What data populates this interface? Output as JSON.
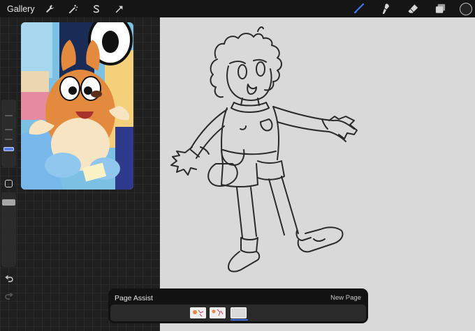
{
  "topbar": {
    "gallery_label": "Gallery",
    "left_tools": [
      "wrench-icon",
      "magic-wand-icon",
      "selection-icon",
      "transform-arrow-icon"
    ],
    "right_tools": [
      "brush-icon",
      "smudge-icon",
      "eraser-icon",
      "layers-icon"
    ],
    "active_tool": "brush-icon",
    "accent_color": "#3d7bf5",
    "current_color": "#232323"
  },
  "sidebar": {
    "size_level": 0.25,
    "opacity_level": 0.9
  },
  "page_assist": {
    "title": "Page Assist",
    "new_page_label": "New Page",
    "page_count": 3,
    "active_page": 3
  },
  "colors": {
    "canvas": "#d9d9d9",
    "background": "#1f1f1f",
    "toolbar": "#151515"
  }
}
